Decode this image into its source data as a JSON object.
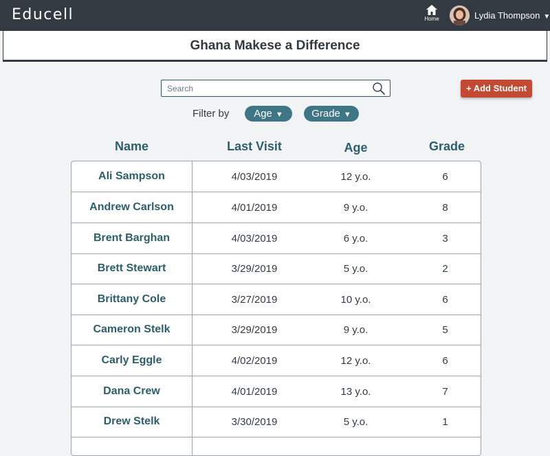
{
  "app": {
    "brand": "Educell"
  },
  "nav": {
    "home_label": "Home",
    "user_name": "Lydia Thompson",
    "user_caret": "▼"
  },
  "page": {
    "title": "Ghana Makese a Difference"
  },
  "toolbar": {
    "search_placeholder": "Search",
    "add_label": "+ Add Student",
    "filter_label": "Filter by",
    "filters": [
      {
        "label": "Age",
        "caret": "▼"
      },
      {
        "label": "Grade",
        "caret": "▼"
      }
    ]
  },
  "table": {
    "headers": {
      "name": "Name",
      "last_visit": "Last Visit",
      "age": "Age",
      "grade": "Grade"
    },
    "rows": [
      {
        "name": "Ali Sampson",
        "last_visit": "4/03/2019",
        "age": "12 y.o.",
        "grade": "6"
      },
      {
        "name": "Andrew Carlson",
        "last_visit": "4/01/2019",
        "age": "9 y.o.",
        "grade": "8"
      },
      {
        "name": "Brent Barghan",
        "last_visit": "4/03/2019",
        "age": "6 y.o.",
        "grade": "3"
      },
      {
        "name": "Brett Stewart",
        "last_visit": "3/29/2019",
        "age": "5 y.o.",
        "grade": "2"
      },
      {
        "name": "Brittany Cole",
        "last_visit": "3/27/2019",
        "age": "10 y.o.",
        "grade": "6"
      },
      {
        "name": "Cameron Stelk",
        "last_visit": "3/29/2019",
        "age": "9 y.o.",
        "grade": "5"
      },
      {
        "name": "Carly Eggle",
        "last_visit": "4/02/2019",
        "age": "12 y.o.",
        "grade": "6"
      },
      {
        "name": "Dana Crew",
        "last_visit": "4/01/2019",
        "age": "13 y.o.",
        "grade": "7"
      },
      {
        "name": "Drew Stelk",
        "last_visit": "3/30/2019",
        "age": "5 y.o.",
        "grade": "1"
      },
      {
        "name": "",
        "last_visit": "",
        "age": "",
        "grade": ""
      }
    ]
  },
  "colors": {
    "topbar": "#333a41",
    "accent_teal": "#3f7685",
    "name_text": "#2c5f6b",
    "add_button": "#c24a32"
  },
  "icons": {
    "home": "home-icon",
    "search": "search-icon",
    "avatar": "avatar"
  }
}
